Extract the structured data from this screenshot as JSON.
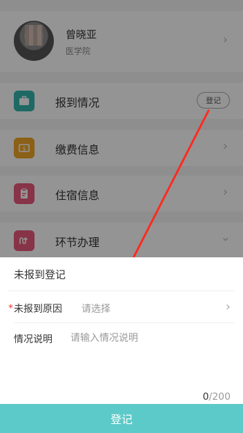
{
  "profile": {
    "name": "曾晓亚",
    "department": "医学院"
  },
  "menu": [
    {
      "label": "报到情况",
      "icon": "briefcase-icon",
      "color": "#36b5ae",
      "action": "登记"
    },
    {
      "label": "缴费信息",
      "icon": "money-icon",
      "color": "#f0a628"
    },
    {
      "label": "住宿信息",
      "icon": "clipboard-icon",
      "color": "#e95b7d"
    },
    {
      "label": "环节办理",
      "icon": "process-icon",
      "color": "#e95b7d",
      "expanded": true
    }
  ],
  "sheet": {
    "title": "未报到登记",
    "required_mark": "*",
    "reason_label": "未报到原因",
    "reason_placeholder": "请选择",
    "description_label": "情况说明",
    "description_placeholder": "请输入情况说明",
    "counter_current": "0",
    "counter_max": "/200",
    "submit_label": "登记"
  },
  "colors": {
    "accent": "#5ccac8",
    "annotation_arrow": "#ff2a1f",
    "required": "#e53935"
  }
}
